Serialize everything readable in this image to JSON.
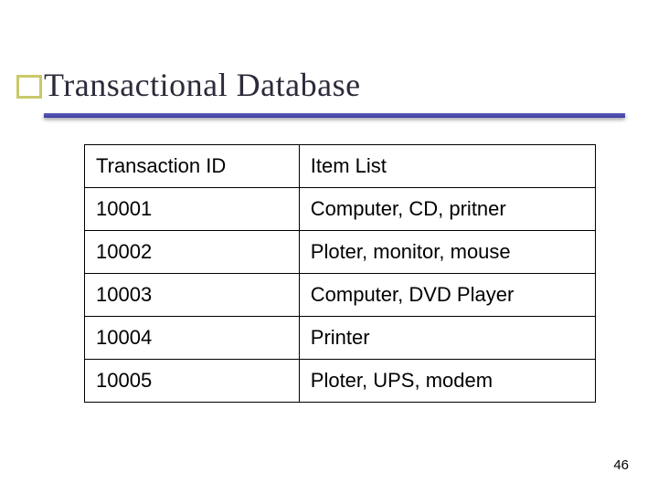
{
  "slide": {
    "title": "Transactional Database",
    "page_number": "46"
  },
  "table": {
    "headers": {
      "transaction_id": "Transaction ID",
      "item_list": "Item List"
    },
    "rows": [
      {
        "id": "10001",
        "items": "Computer, CD, pritner"
      },
      {
        "id": "10002",
        "items": "Ploter, monitor, mouse"
      },
      {
        "id": "10003",
        "items": "Computer, DVD Player"
      },
      {
        "id": "10004",
        "items": "Printer"
      },
      {
        "id": "10005",
        "items": "Ploter, UPS, modem"
      }
    ]
  }
}
